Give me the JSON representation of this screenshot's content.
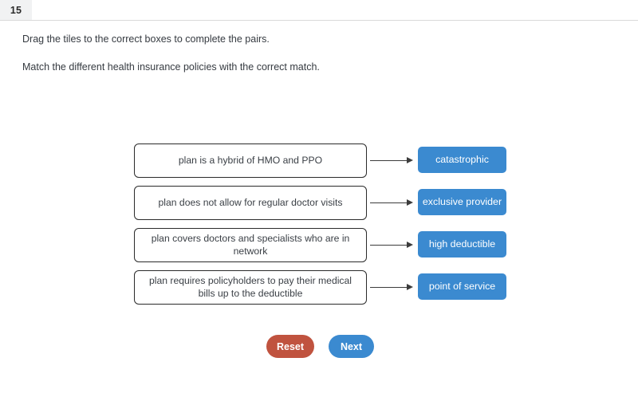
{
  "header": {
    "question_number": "15"
  },
  "instructions": {
    "line1": "Drag the tiles to the correct boxes to complete the pairs.",
    "line2": "Match the different health insurance policies with the correct match."
  },
  "match_rows": [
    {
      "prompt": "plan is a hybrid of HMO and PPO",
      "answer": "catastrophic"
    },
    {
      "prompt": "plan does not allow for regular doctor visits",
      "answer": "exclusive provider"
    },
    {
      "prompt": "plan covers doctors and specialists who are in network",
      "answer": "high deductible"
    },
    {
      "prompt": "plan requires policyholders to pay their medical bills up to the deductible",
      "answer": "point of service"
    }
  ],
  "buttons": {
    "reset_label": "Reset",
    "next_label": "Next"
  },
  "colors": {
    "tile_blue": "#3b8ad0",
    "reset_red": "#c0533f",
    "next_blue": "#3b8ad0",
    "box_border": "#2a2a2a",
    "tab_background": "#f1f2f3",
    "text": "#353a40"
  }
}
